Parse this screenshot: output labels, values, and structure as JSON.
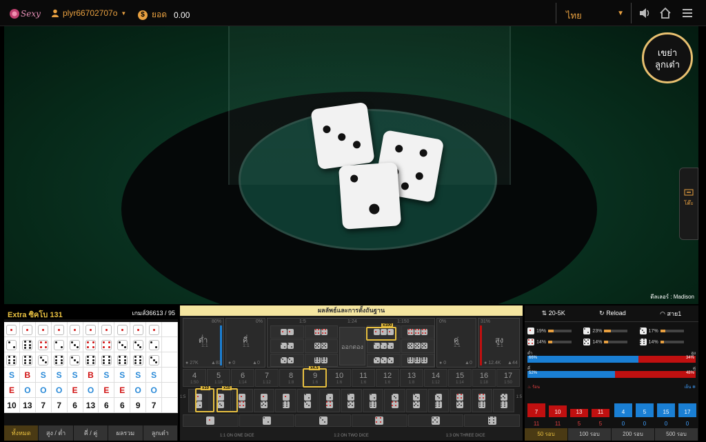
{
  "header": {
    "username": "plyr66702707o",
    "balance_label": "ยอด",
    "balance_value": "0.00",
    "language": "ไทย"
  },
  "video": {
    "shake_button_line1": "เขย่า",
    "shake_button_line2": "ลูกเต๋า",
    "dealer": "ดีลเลอร์ : Madison",
    "side_tab_label": "โต๊ะ"
  },
  "roadmap": {
    "table_name": "Extra ซิคโบ 131",
    "game_count": "เกมส์36613 / 95",
    "dice_rows": [
      [
        1,
        1,
        1,
        1,
        1,
        1,
        1,
        1,
        1,
        1
      ],
      [
        2,
        6,
        4,
        2,
        3,
        4,
        4,
        3,
        3,
        2
      ],
      [
        6,
        6,
        3,
        6,
        3,
        6,
        6,
        6,
        6,
        3
      ]
    ],
    "size_row": [
      "S",
      "B",
      "S",
      "S",
      "S",
      "B",
      "S",
      "S",
      "S",
      "S"
    ],
    "parity_row": [
      "E",
      "O",
      "O",
      "O",
      "E",
      "O",
      "E",
      "E",
      "O",
      "O"
    ],
    "sum_row": [
      "10",
      "13",
      "7",
      "7",
      "6",
      "13",
      "6",
      "6",
      "9",
      "7"
    ],
    "tabs": [
      "ทั้งหมด",
      "สูง / ต่ำ",
      "คี่ / คู่",
      "ผลรวม",
      "ลูกเต๋า"
    ]
  },
  "board": {
    "title": "ผลลัพธ์และการตั้งถันฐาน",
    "small_label": "ต่ำ",
    "small_odds": "1:1",
    "small_pct": "80%",
    "small_count1": "27K",
    "small_count2": "83",
    "odd_label": "คี่",
    "odd_odds": "1:1",
    "odd_pct": "0%",
    "odd_count1": "0",
    "odd_count2": "0",
    "triple_odds": "1:5",
    "any_triple_odds": "1:24",
    "triple_odds_right": "1:150",
    "any_triple_label": "ออกตอง",
    "even_label": "คู่",
    "even_odds": "1:1",
    "even_pct": "0%",
    "even_count1": "0",
    "even_count2": "0",
    "big_label": "สูง",
    "big_odds": "1:1",
    "big_pct": "31%",
    "big_count1": "12.4K",
    "big_count2": "44",
    "mult_triple": "x100",
    "totals": [
      {
        "n": "4",
        "o": "1:50"
      },
      {
        "n": "5",
        "o": "1:18"
      },
      {
        "n": "6",
        "o": "1:14"
      },
      {
        "n": "7",
        "o": "1:12"
      },
      {
        "n": "8",
        "o": "1:8"
      },
      {
        "n": "9",
        "o": "1:6"
      },
      {
        "n": "10",
        "o": "1:6"
      },
      {
        "n": "11",
        "o": "1:6"
      },
      {
        "n": "12",
        "o": "1:6"
      },
      {
        "n": "13",
        "o": "1:8"
      },
      {
        "n": "14",
        "o": "1:12"
      },
      {
        "n": "15",
        "o": "1:14"
      },
      {
        "n": "16",
        "o": "1:18"
      },
      {
        "n": "17",
        "o": "1:50"
      }
    ],
    "mult_total": "x4.5",
    "pair_left_odds": "1:5",
    "pair_right_odds": "1:5",
    "mult_pair_a": "x10",
    "mult_pair_b": "x10",
    "foot": [
      "1:1 ON ONE DICE",
      "1:2 ON TWO DICE",
      "1:3 ON THREE DICE"
    ]
  },
  "stats": {
    "limit": "20-5K",
    "reload": "Reload",
    "line": "สาย1",
    "faces": [
      {
        "face": 1,
        "pct": "19%",
        "v": 0.19
      },
      {
        "face": 2,
        "pct": "23%",
        "v": 0.23
      },
      {
        "face": 3,
        "pct": "17%",
        "v": 0.17
      },
      {
        "face": 4,
        "pct": "14%",
        "v": 0.14
      },
      {
        "face": 5,
        "pct": "14%",
        "v": 0.14
      },
      {
        "face": 6,
        "pct": "14%",
        "v": 0.14
      }
    ],
    "small_label": "ต่ำ",
    "big_label": "สูง",
    "small_pct": "66%",
    "big_pct": "34%",
    "small_v": 0.66,
    "odd_label": "คี่",
    "even_label": "คู่",
    "odd_pct": "52%",
    "even_pct": "48%",
    "odd_v": 0.52,
    "hot_label": "ร้อน",
    "cold_label": "เย็น",
    "hot": [
      {
        "n": "7",
        "c": "11",
        "h": 20
      },
      {
        "n": "10",
        "c": "11",
        "h": 17
      },
      {
        "n": "13",
        "c": "5",
        "h": 12
      },
      {
        "n": "11",
        "c": "5",
        "h": 12
      }
    ],
    "cold": [
      {
        "n": "4",
        "c": "0",
        "h": 20
      },
      {
        "n": "5",
        "c": "0",
        "h": 20
      },
      {
        "n": "15",
        "c": "0",
        "h": 20
      },
      {
        "n": "17",
        "c": "0",
        "h": 20
      }
    ],
    "tabs": [
      "50 รอบ",
      "100 รอบ",
      "200 รอบ",
      "500 รอบ"
    ]
  }
}
